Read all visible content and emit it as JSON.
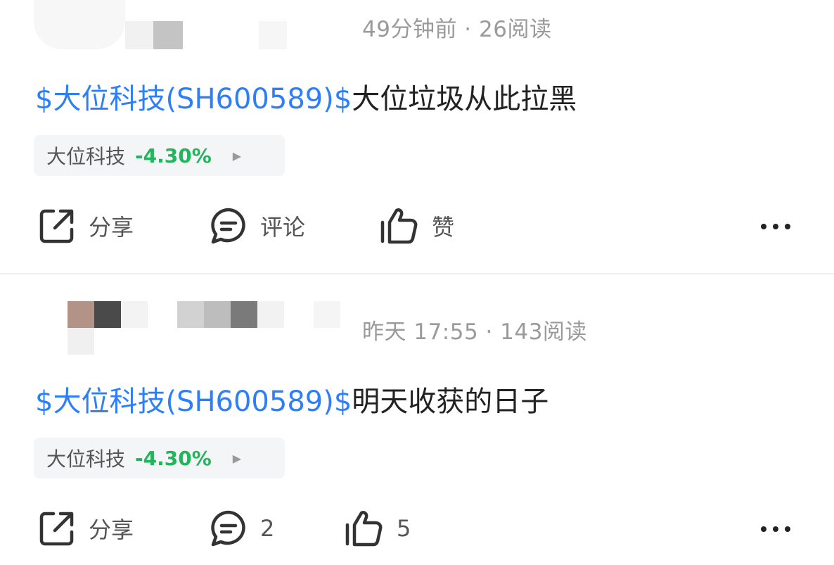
{
  "posts": [
    {
      "meta": "49分钟前 · 26阅读",
      "content": {
        "link": "$大位科技(SH600589)$",
        "text": "大位垃圾从此拉黑"
      },
      "stock": {
        "name": "大位科技",
        "change": "-4.30%",
        "change_color": "#22b55c"
      },
      "actions": {
        "share": "分享",
        "comment": "评论",
        "like": "赞"
      }
    },
    {
      "meta": "昨天 17:55 · 143阅读",
      "content": {
        "link": "$大位科技(SH600589)$",
        "text": "明天收获的日子"
      },
      "stock": {
        "name": "大位科技",
        "change": "-4.30%",
        "change_color": "#22b55c"
      },
      "actions": {
        "share": "分享",
        "comment": "2",
        "like": "5"
      }
    }
  ],
  "colors": {
    "link": "#2d7ff9",
    "meta": "#9a9a9a",
    "text": "#222222"
  },
  "icons": {
    "share": "share-icon",
    "comment": "comment-icon",
    "like": "thumbs-up-icon",
    "more": "more-icon",
    "arrow": "chevron-right-icon"
  }
}
